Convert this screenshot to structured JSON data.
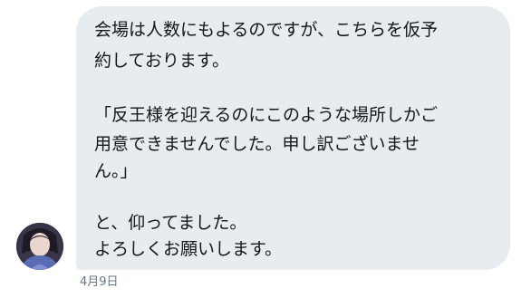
{
  "message": {
    "lines": [
      "会場は人数にもよるのですが、こちらを仮予",
      "約しております。",
      "「反王様を迎えるのにこのような場所しかご",
      "用意できませんでした。申し訳ございませ",
      "ん。」",
      "と、仰ってました。",
      "よろしくお願いします。"
    ],
    "timestamp": "4月9日"
  },
  "avatar": {
    "icon": "user-avatar"
  },
  "colors": {
    "bubble": "#e6ecf0",
    "text": "#14171a",
    "timestamp": "#657786"
  }
}
